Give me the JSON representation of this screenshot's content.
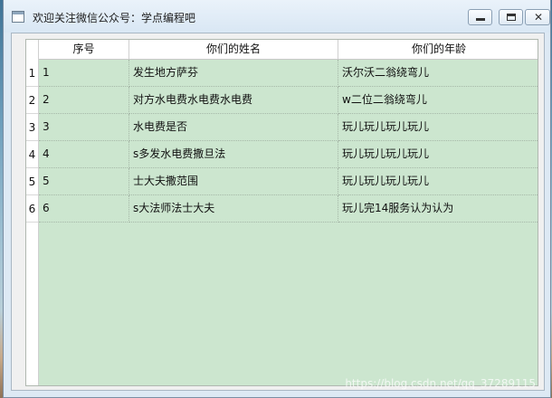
{
  "window": {
    "title": "欢迎关注微信公众号：学点编程吧",
    "caption_buttons": [
      {
        "name": "minimize",
        "icon": "minimize-icon"
      },
      {
        "name": "maximize",
        "icon": "maximize-icon"
      },
      {
        "name": "close",
        "icon": "close-icon",
        "glyph": "✕"
      }
    ]
  },
  "table": {
    "columns": [
      "序号",
      "你们的姓名",
      "你们的年龄"
    ],
    "row_headers": [
      "1",
      "2",
      "3",
      "4",
      "5",
      "6"
    ],
    "rows": [
      [
        "1",
        "发生地方萨芬",
        "沃尔沃二翁绕弯儿"
      ],
      [
        "2",
        "对方水电费水电费水电费",
        "w二位二翁绕弯儿"
      ],
      [
        "3",
        "水电费是否",
        "玩儿玩儿玩儿玩儿"
      ],
      [
        "4",
        "s多发水电费撒旦法",
        "玩儿玩儿玩儿玩儿"
      ],
      [
        "5",
        "士大夫撒范围",
        "玩儿玩儿玩儿玩儿"
      ],
      [
        "6",
        "s大法师法士大夫",
        "玩儿完14服务认为认为"
      ]
    ],
    "background_color": "#cce6cf"
  },
  "watermark": "https://blog.csdn.net/qq_37289115"
}
